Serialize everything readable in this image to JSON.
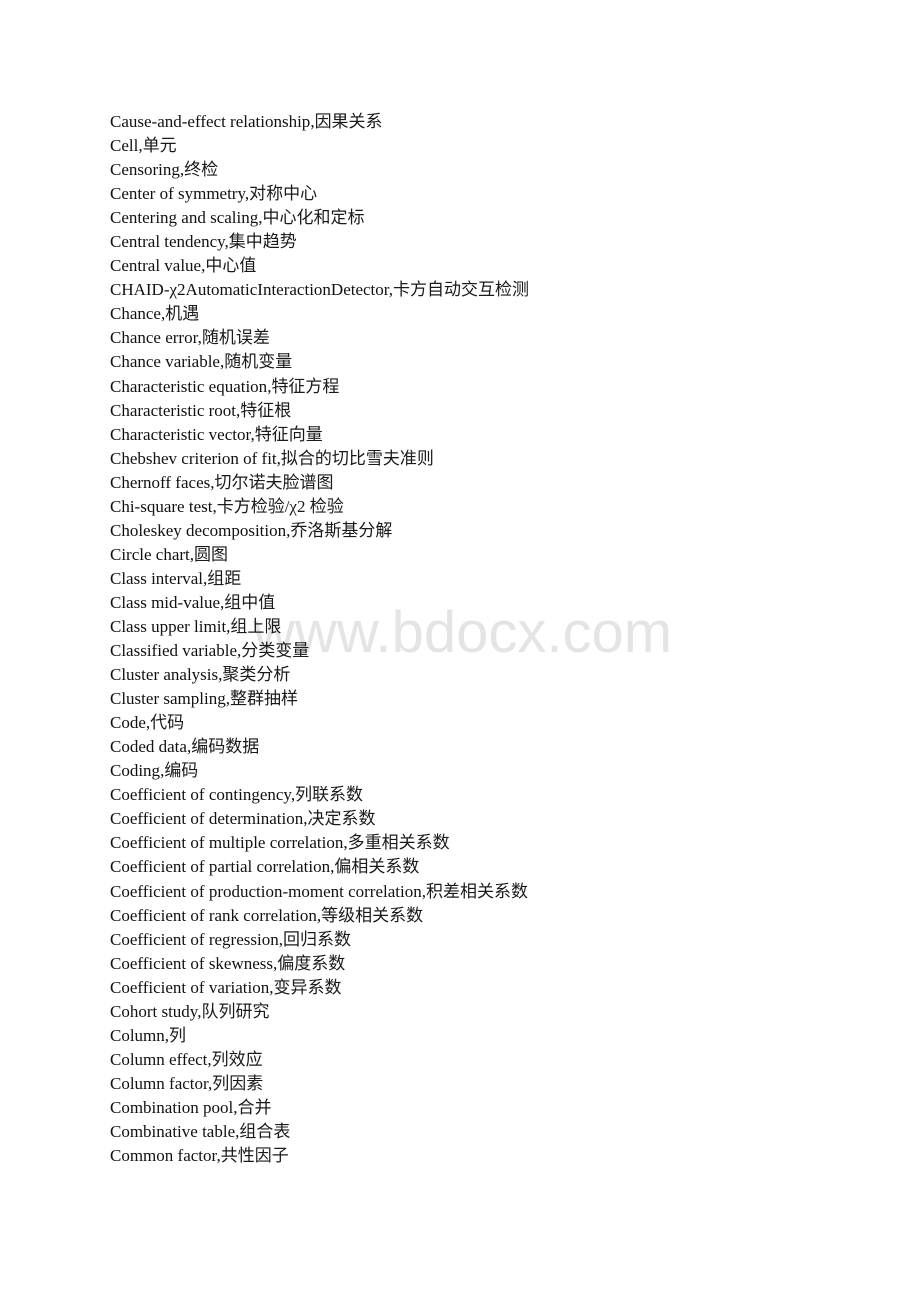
{
  "watermark": "www.bdocx.com",
  "entries": [
    {
      "en": "Cause-and-effect relationship",
      "zh": "因果关系"
    },
    {
      "en": "Cell",
      "zh": "单元"
    },
    {
      "en": "Censoring",
      "zh": "终检"
    },
    {
      "en": "Center of symmetry",
      "zh": "对称中心"
    },
    {
      "en": "Centering and scaling",
      "zh": "中心化和定标"
    },
    {
      "en": "Central tendency",
      "zh": "集中趋势"
    },
    {
      "en": "Central value",
      "zh": "中心值"
    },
    {
      "en": "CHAID-χ2AutomaticInteractionDetector",
      "zh": "卡方自动交互检测"
    },
    {
      "en": "Chance",
      "zh": "机遇"
    },
    {
      "en": "Chance error",
      "zh": "随机误差"
    },
    {
      "en": "Chance variable",
      "zh": "随机变量"
    },
    {
      "en": "Characteristic equation",
      "zh": "特征方程"
    },
    {
      "en": "Characteristic root",
      "zh": "特征根"
    },
    {
      "en": "Characteristic vector",
      "zh": "特征向量"
    },
    {
      "en": "Chebshev criterion of fit",
      "zh": "拟合的切比雪夫准则"
    },
    {
      "en": "Chernoff faces",
      "zh": "切尔诺夫脸谱图"
    },
    {
      "en": "Chi-square test",
      "zh": "卡方检验/χ2 检验"
    },
    {
      "en": "Choleskey decomposition",
      "zh": "乔洛斯基分解"
    },
    {
      "en": "Circle chart",
      "zh": "圆图"
    },
    {
      "en": "Class interval",
      "zh": "组距"
    },
    {
      "en": "Class mid-value",
      "zh": "组中值"
    },
    {
      "en": "Class upper limit",
      "zh": "组上限"
    },
    {
      "en": "Classified variable",
      "zh": "分类变量"
    },
    {
      "en": "Cluster analysis",
      "zh": "聚类分析"
    },
    {
      "en": "Cluster sampling",
      "zh": "整群抽样"
    },
    {
      "en": "Code",
      "zh": "代码"
    },
    {
      "en": "Coded data",
      "zh": "编码数据"
    },
    {
      "en": "Coding",
      "zh": "编码"
    },
    {
      "en": "Coefficient of contingency",
      "zh": "列联系数"
    },
    {
      "en": "Coefficient of determination",
      "zh": "决定系数"
    },
    {
      "en": "Coefficient of multiple correlation",
      "zh": "多重相关系数"
    },
    {
      "en": "Coefficient of partial correlation",
      "zh": "偏相关系数"
    },
    {
      "en": "Coefficient of production-moment correlation",
      "zh": "积差相关系数"
    },
    {
      "en": "Coefficient of rank correlation",
      "zh": "等级相关系数"
    },
    {
      "en": "Coefficient of regression",
      "zh": "回归系数"
    },
    {
      "en": "Coefficient of skewness",
      "zh": "偏度系数"
    },
    {
      "en": "Coefficient of variation",
      "zh": "变异系数"
    },
    {
      "en": "Cohort study",
      "zh": "队列研究"
    },
    {
      "en": "Column",
      "zh": "列"
    },
    {
      "en": "Column effect",
      "zh": "列效应"
    },
    {
      "en": "Column factor",
      "zh": "列因素"
    },
    {
      "en": "Combination pool",
      "zh": "合并"
    },
    {
      "en": "Combinative table",
      "zh": "组合表"
    },
    {
      "en": "Common factor",
      "zh": "共性因子"
    }
  ],
  "separator": ","
}
